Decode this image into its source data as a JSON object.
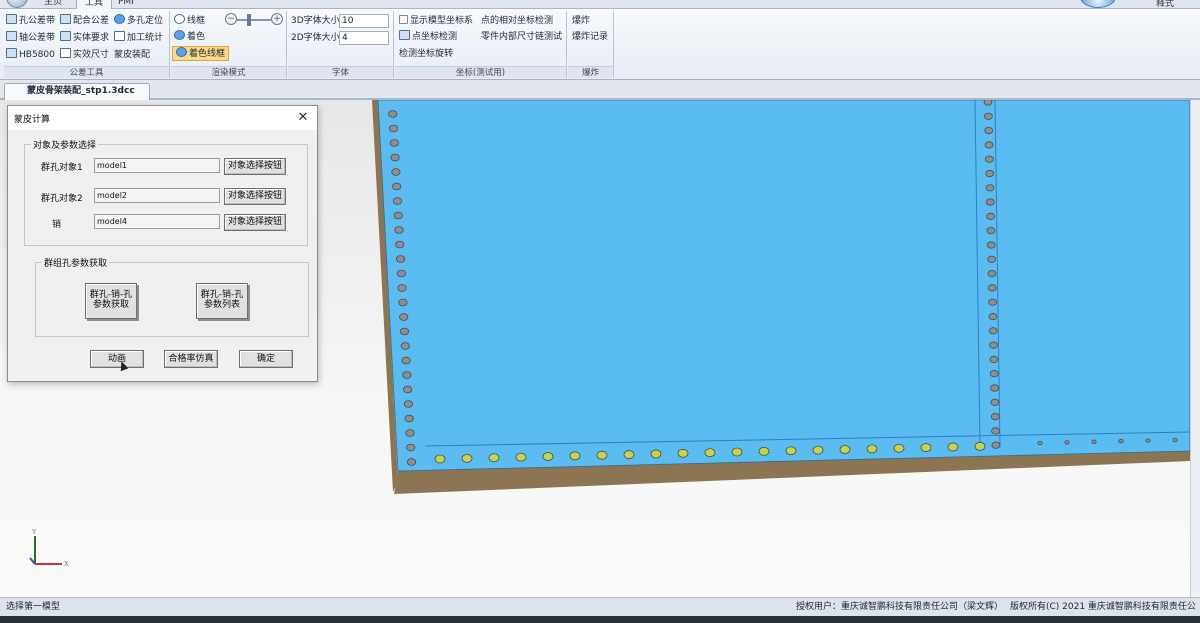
{
  "ribbon_tabs": [
    "主页",
    "工具",
    "PMI"
  ],
  "top_right_text": "释式",
  "groups": {
    "tolerance": {
      "title": "公差工具",
      "buttons": [
        "孔公差带",
        "配合公差",
        "多孔定位",
        "轴公差带",
        "实体要求",
        "加工统计",
        "HB5800",
        "实效尺寸",
        "蒙皮装配"
      ]
    },
    "render": {
      "title": "渲染模式",
      "buttons": [
        "线框",
        "着色",
        "着色线框"
      ],
      "slider_level": 0.35
    },
    "font": {
      "title": "字体",
      "label_3d": "3D字体大小",
      "value_3d": "10",
      "label_2d": "2D字体大小",
      "value_2d": "4"
    },
    "coord": {
      "title": "坐标(测试用)",
      "buttons": [
        "显示模型坐标系",
        "点的相对坐标检测",
        "点坐标检测",
        "零件内部尺寸链测试",
        "检测坐标旋转"
      ]
    },
    "explode": {
      "title": "爆炸",
      "buttons": [
        "爆炸",
        "爆炸记录"
      ]
    }
  },
  "document_tab": "蒙皮骨架装配_stp1.3dcc",
  "dialog": {
    "title": "蒙皮计算",
    "close_glyph": "✕",
    "group1_title": "对象及参数选择",
    "rows": [
      {
        "label": "群孔对象1",
        "value": "model1",
        "button": "对象选择按钮"
      },
      {
        "label": "群孔对象2",
        "value": "model2",
        "button": "对象选择按钮"
      },
      {
        "label": "销",
        "value": "model4",
        "button": "对象选择按钮"
      }
    ],
    "group2_title": "群组孔参数获取",
    "big_buttons": [
      {
        "line1": "群孔-销-孔",
        "line2": "参数获取"
      },
      {
        "line1": "群孔-销-孔",
        "line2": "参数列表"
      }
    ],
    "bottom_buttons": [
      "动画",
      "合格率仿真",
      "确定"
    ]
  },
  "axis": {
    "y": "Y",
    "x": "X"
  },
  "status": {
    "left": "选择第一模型",
    "user": "授权用户：重庆诚智鹏科技有限责任公司（梁文辉）",
    "copyright": "版权所有(C) 2021 重庆诚智鹏科技有限责任公司"
  },
  "colors": {
    "panel": "#5bbcf2",
    "panel_edge": "#8b7552",
    "hole": "#8e8e8e",
    "hole_pin": "#c9d34a"
  }
}
